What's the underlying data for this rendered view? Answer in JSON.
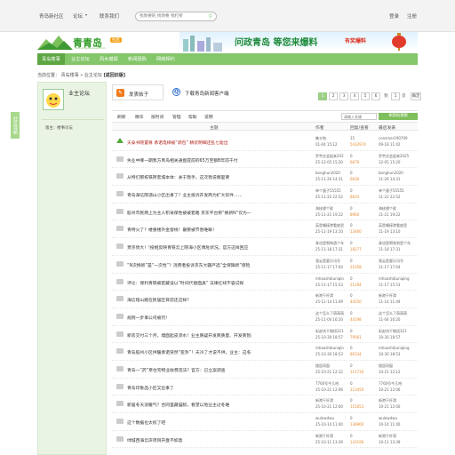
{
  "topbar": {
    "links": [
      "青岛新社区",
      "论坛",
      "联系我们"
    ],
    "search_placeholder": "找你要的 找你要 找打折",
    "login": "登录",
    "register": "注册"
  },
  "logo": {
    "text": "青青岛",
    "sub": "club.qingdaonews.com",
    "badge": "社区"
  },
  "banner": {
    "text": "问政青岛 等您来爆料",
    "tag": "有奖爆料"
  },
  "nav": [
    "青岛楼事",
    "业主论坛",
    "风水堪舆",
    "新闻团购",
    "网络相约"
  ],
  "breadcrumb": {
    "prefix": "当前位置：",
    "items": [
      "青岛楼事",
      "业主论坛"
    ],
    "current": "[返回旧版]"
  },
  "left_tab": "社区导航",
  "sidebar": {
    "forum_title": "业主论坛",
    "moderator": "版主：楼事论坛"
  },
  "actions": {
    "post": "发表帖子",
    "download": "下载青岛新闻客户端"
  },
  "pager": {
    "pages": [
      "1",
      "2",
      "3",
      "4",
      "5",
      "6"
    ],
    "current_page": "1",
    "prefix": "到",
    "suffix": "页",
    "go": "确定",
    "input_value": "1"
  },
  "filters": [
    "刷新",
    "精华",
    "按时间",
    "管理",
    "帮助",
    "说明"
  ],
  "search": {
    "placeholder": "请输入关键",
    "button": "本版帖搜索"
  },
  "table_headers": {
    "title": "主题",
    "author": "作者",
    "reply_views": "回复/查看",
    "last": "最后发表"
  },
  "threads": [
    {
      "title": "天泰书院置尊 承诺电梯被“调包” 精装明细还乱七能出",
      "author": "集丰和",
      "date": "01-04 15:12",
      "replies": "15",
      "views": "5432974",
      "last_user": "consmer190709",
      "last_time": "09-18 11:42",
      "pinned": true,
      "hot": true
    },
    {
      "title": "失业中哪一期我方青岛相关通盘提前的65万至额B年前干付",
      "author": "罗劳业会起来202",
      "date": "25-12-05 15:20",
      "replies": "0",
      "views": "6679",
      "last_user": "罗劳业会起来2025",
      "last_time": "12-05 15:20",
      "pinned": false,
      "hot": false
    },
    {
      "title": "从特们那栋铁砖套城本体：关于我手。这次我说哪里要",
      "author": "bonghun2020",
      "date": "25-11-26 14:31",
      "replies": "0",
      "views": "6636",
      "last_user": "bonghun2020",
      "last_time": "11-26 14:31",
      "pinned": false,
      "hot": false
    },
    {
      "title": "青岛海信院浦山小区出事了？业主投诉开发商为扩大装件……",
      "author": "单个量子55555",
      "date": "25-11-22 22:52",
      "replies": "0",
      "views": "8620",
      "last_user": "单个量子55555",
      "last_time": "11-22 22:52",
      "pinned": false,
      "hot": false
    },
    {
      "title": "胶州市民两上为主人积采保性被被套路 京东平台称“换新N”仅为一次",
      "author": "海核望个款",
      "date": "25-11-21 19:22",
      "replies": "0",
      "views": "8960",
      "last_user": "海核望个款",
      "last_time": "11-21 19:22",
      "pinned": false,
      "hot": false
    },
    {
      "title": "青特火了？楼重楼外金窗线！最要被节善唯嘛！",
      "author": "英是嘴接港看座里",
      "date": "25-11-19 13:10",
      "replies": "0",
      "views": "13460",
      "last_user": "英是嘴接港看座里",
      "last_time": "11-19 13:10",
      "pinned": false,
      "hot": false
    },
    {
      "title": "贵京债大！!投框反映青铁云上院海小区傅危状况。官方这样回应",
      "author": "青也是啊和酒个车",
      "date": "25-11-18 17:31",
      "replies": "0",
      "views": "18277",
      "last_user": "青也是啊和到是个车",
      "last_time": "11-18 17:31",
      "pinned": false,
      "hot": false
    },
    {
      "title": "“N次换新”是“一次性”？消费者投诉京东大疆严选“全保障新”保险",
      "author": "我云是要乐讯号",
      "date": "25-11-17 17:04",
      "replies": "0",
      "views": "21058",
      "last_user": "我云是要乐讯号",
      "last_time": "11-17 17:04",
      "pinned": false,
      "hot": false
    },
    {
      "title": "评论：保利青铁被套藏设以“时间代替面具” 法律红线不容试探",
      "author": "mhaoshibuniqin",
      "date": "25-11-17 15:53",
      "replies": "0",
      "views": "21294",
      "last_user": "mhaoshibuniqing",
      "last_time": "11-17 15:53",
      "pinned": false,
      "hot": false
    },
    {
      "title": "海信铭山路在民居区目前还这样？",
      "author": "新港干杆滑",
      "date": "25-11-14 11:49",
      "replies": "0",
      "views": "44250",
      "last_user": "新港干杆滑",
      "last_time": "11-14 11:49",
      "pinned": false,
      "hot": false
    },
    {
      "title": "规则一步事公司被罚！",
      "author": "这个怎么了萌萌萌",
      "date": "25-11-04 16:20",
      "replies": "0",
      "views": "44198",
      "last_user": "这个怎么了萌萌萌",
      "last_time": "11-04 16:20",
      "pinned": false,
      "hot": false
    },
    {
      "title": "新房交付三个月，墙面起皮渗水！业主质疑开发商质量、开发商暂未回应",
      "author": "彩赵块干物班321",
      "date": "25-10-30 18:57",
      "replies": "0",
      "views": "79561",
      "last_user": "彩赵块干物班321",
      "last_time": "10-30 18:57",
      "pinned": false,
      "hot": false
    },
    {
      "title": "青岛胶州小区供暖承诺突然“变卦”！天冷了才说不供，业主：这冬天咋",
      "author": "mhaoshibuniqin",
      "date": "25-10-30 18:53",
      "replies": "0",
      "views": "80334",
      "last_user": "mhaoshibuniqing",
      "last_time": "10-30 18:53",
      "pinned": false,
      "hot": false
    },
    {
      "title": "青岛一“药”亲住宅物业收费违法？官方：已立案调查",
      "author": "楼居同窗",
      "date": "25-10-21 12:12",
      "replies": "0",
      "views": "111730",
      "last_user": "楼居同窗",
      "last_time": "10-21 12:12",
      "pinned": false,
      "hot": false
    },
    {
      "title": "青岛印象品小区又出事了",
      "author": "7760号今几哈",
      "date": "25-10-21 12:06",
      "replies": "0",
      "views": "113450",
      "last_user": "7760号今几哈",
      "last_time": "10-21 12:06",
      "pinned": false,
      "hot": false
    },
    {
      "title": "新居冬天没暖气？合同里藏猫腻，看望以地业主过冬难",
      "author": "新港干杆滑",
      "date": "25-10-21 12:00",
      "replies": "0",
      "views": "115053",
      "last_user": "新港干杆滑",
      "last_time": "10-21 12:00",
      "pinned": false,
      "hot": false
    },
    {
      "title": "这个数据也太权了吧",
      "author": "wulewdwu",
      "date": "25-10-14 11:40",
      "replies": "0",
      "views": "138960",
      "last_user": "wulewdwu",
      "last_time": "10-14 11:40",
      "pinned": false,
      "hot": false
    },
    {
      "title": "绿城西海云声项目开盘不如意",
      "author": "新港干杆滑",
      "date": "25-10-11 13:39",
      "replies": "0",
      "views": "143196",
      "last_user": "新港干杆滑",
      "last_time": "10-11 13:39",
      "pinned": false,
      "hot": false
    }
  ]
}
